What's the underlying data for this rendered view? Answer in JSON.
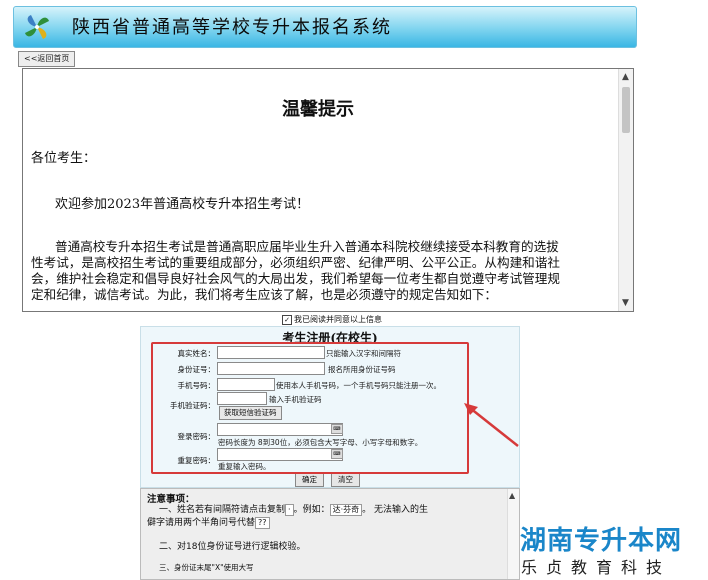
{
  "header": {
    "title": "陕西省普通高等学校专升本报名系统",
    "logo_icon": "pinwheel-logo-icon"
  },
  "nav": {
    "back_label": "<<返回首页"
  },
  "notice": {
    "title": "温馨提示",
    "greeting": "各位考生：",
    "welcome": "欢迎参加2023年普通高校专升本招生考试！",
    "body": "普通高校专升本招生考试是普通高职应届毕业生升入普通本科院校继续接受本科教育的选拔性考试，是高校招生考试的重要组成部分，必须组织严密、纪律严明、公平公正。从构建和谐社会，维护社会稳定和倡导良好社会风气的大局出发，我们希望每一位考生都自觉遵守考试管理规定和纪律，诚信考试。为此，我们将考生应该了解，也是必须遵守的规定告知如下："
  },
  "agree": {
    "label": "我已阅读并同意以上信息",
    "checked": true
  },
  "form": {
    "title": "考生注册(在校生)",
    "fields": [
      {
        "label": "真实姓名：",
        "hint": "只能输入汉字和间隔符"
      },
      {
        "label": "身份证号：",
        "hint": "报名所用身份证号码"
      },
      {
        "label": "手机号码：",
        "hint": "使用本人手机号码，一个手机号码只能注册一次。"
      },
      {
        "label": "手机验证码：",
        "hint": "输入手机验证码",
        "button": "获取短信验证码"
      },
      {
        "label": "登录密码：",
        "hint": "密码长度为 8到30位，必须包含大写字母、小写字母和数字。"
      },
      {
        "label": "重复密码：",
        "hint": "重复输入密码。"
      }
    ],
    "confirm_label": "确定",
    "clear_label": "清空"
  },
  "notes": {
    "title": "注意事项：",
    "item1_a": "一、姓名若有间隔符请点击复制",
    "item1_sym": "·",
    "item1_b": "。例如：",
    "item1_example": "达·芬奇",
    "item1_c": "。 无法输入的生",
    "item1_d": "僻字请用两个半角问号代替",
    "item1_q": "??",
    "item2": "二、对18位身份证号进行逻辑校验。",
    "item3": "三、身份证末尾\"X\"使用大写"
  },
  "watermark": {
    "title": "湖南专升本网",
    "subtitle": "乐贞教育科技"
  },
  "colors": {
    "highlight_box": "#d63a3a",
    "header_blue": "#3ab6e4",
    "watermark_blue": "#1a86c9"
  }
}
